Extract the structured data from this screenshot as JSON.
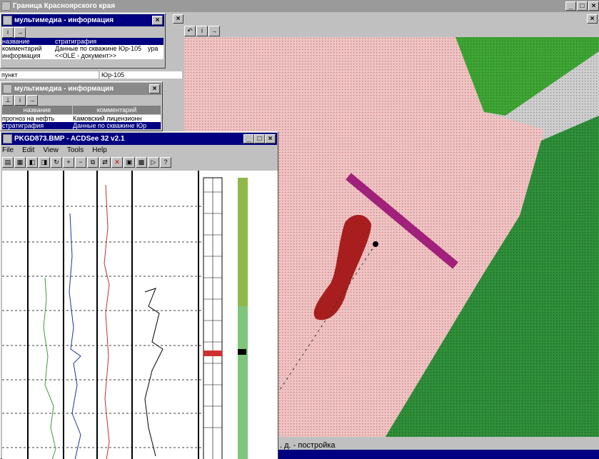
{
  "main_window": {
    "title": "Граница Красноярского края",
    "controls": [
      "_",
      "□",
      "×"
    ],
    "second_close": "×"
  },
  "map": {
    "colors": {
      "pink": "#f0c8c8",
      "dark_green": "#2e8b3c",
      "light_green": "#3fa536",
      "grey": "#c8c8c8",
      "magenta": "#a0207a",
      "red": "#a82020"
    }
  },
  "multimedia1": {
    "title": "мультимедиа - информация",
    "rows": [
      {
        "name": "название",
        "value": "стратиграфия",
        "extra": ""
      },
      {
        "name": "комментарий",
        "value": "Данные по скважине Юр-105",
        "extra": "ура"
      },
      {
        "name": "информация",
        "value": "<<OLE - документ>>",
        "extra": ""
      }
    ]
  },
  "form": {
    "field1": "пункт",
    "field2": "Юр-105"
  },
  "multimedia2": {
    "title": "мультимедиа - информация",
    "headers": [
      "название",
      "комментарий"
    ],
    "rows": [
      {
        "name": "прогноз на нефть",
        "value": "Камовский лицензионн"
      },
      {
        "name": "стратиграфия",
        "value": "Данные по скважине Юр"
      }
    ]
  },
  "acdsee": {
    "title": "PKGD873.BMP - ACDSee 32 v2.1",
    "menu": [
      "File",
      "Edit",
      "View",
      "Tools",
      "Help"
    ]
  },
  "status": {
    "label": ". д. - постройка"
  }
}
